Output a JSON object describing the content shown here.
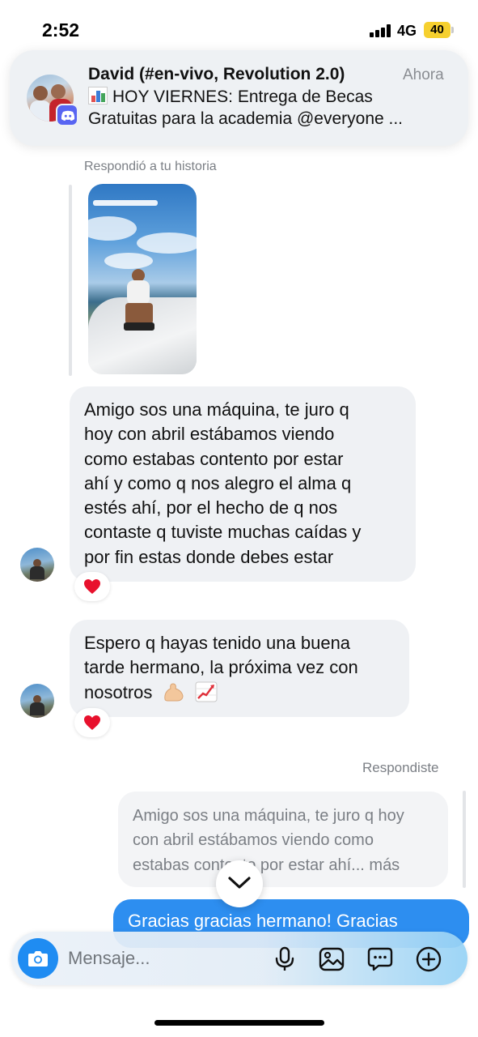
{
  "status_bar": {
    "time": "2:52",
    "network": "4G",
    "battery": "40",
    "battery_color": "#f6d02f"
  },
  "notification": {
    "app_icon": "discord-icon",
    "title": "David (#en-vivo, Revolution 2.0)",
    "time": "Ahora",
    "line1": "HOY VIERNES: Entrega de Becas",
    "line1_icon": "bar-chart-emoji",
    "line2": "Gratuitas para la academia @everyone ..."
  },
  "conversation": {
    "story_label": "Respondió a tu historia",
    "messages_in": [
      {
        "lines": [
          "Amigo sos una máquina, te juro q",
          "hoy con abril estábamos viendo",
          "como estabas contento por estar",
          "ahí y como q nos alegro el alma q",
          "estés ahí, por el hecho de q nos",
          "contaste q tuviste muchas caídas y",
          "por fin estas donde debes estar"
        ],
        "reaction": "heart"
      },
      {
        "lines": [
          "Espero q hayas tenido una buena",
          "tarde hermano, la próxima vez con",
          "nosotros"
        ],
        "emojis": [
          "flexed-biceps-emoji",
          "chart-increasing-emoji"
        ],
        "reaction": "heart"
      }
    ],
    "replied_label": "Respondiste",
    "quoted_lines": [
      "Amigo sos una máquina, te juro q hoy",
      "con abril estábamos viendo como",
      "estabas contento por estar ahí... más"
    ],
    "message_out": "Gracias gracias hermano! Gracias"
  },
  "composer": {
    "placeholder": "Mensaje...",
    "icons": [
      "camera-icon",
      "microphone-icon",
      "gallery-icon",
      "sticker-icon",
      "add-icon"
    ]
  },
  "colors": {
    "accent": "#2d8ef0",
    "incoming_bubble": "#eff1f4",
    "discord": "#5865f2",
    "heart": "#e8112d"
  }
}
